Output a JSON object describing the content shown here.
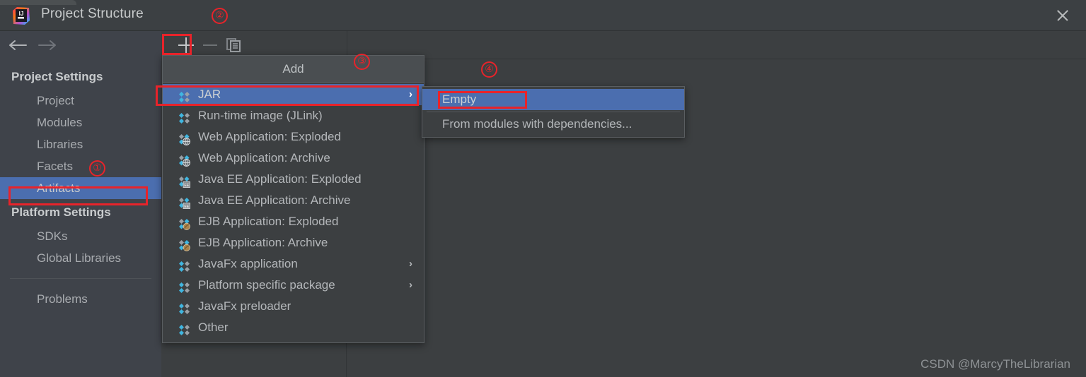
{
  "window": {
    "title": "Project Structure",
    "logo_icon": "intellij-idea-logo",
    "close_icon": "close-icon"
  },
  "nav": {
    "back_icon": "arrow-left-icon",
    "forward_icon": "arrow-right-icon"
  },
  "sidebar": {
    "groups": [
      {
        "label": "Project Settings",
        "items": [
          {
            "label": "Project",
            "selected": false
          },
          {
            "label": "Modules",
            "selected": false
          },
          {
            "label": "Libraries",
            "selected": false
          },
          {
            "label": "Facets",
            "selected": false
          },
          {
            "label": "Artifacts",
            "selected": true
          }
        ]
      },
      {
        "label": "Platform Settings",
        "items": [
          {
            "label": "SDKs",
            "selected": false
          },
          {
            "label": "Global Libraries",
            "selected": false
          }
        ]
      }
    ],
    "footer_items": [
      {
        "label": "Problems",
        "selected": false
      }
    ]
  },
  "toolbar": {
    "add_icon": "plus-icon",
    "remove_icon": "minus-icon",
    "copy_icon": "copy-icon"
  },
  "add_menu": {
    "header": "Add",
    "items": [
      {
        "label": "JAR",
        "icon": "artifact-jar-icon",
        "selected": true,
        "submenu": true
      },
      {
        "label": "Run-time image (JLink)",
        "icon": "artifact-jar-icon",
        "selected": false,
        "submenu": false
      },
      {
        "label": "Web Application: Exploded",
        "icon": "artifact-web-icon",
        "selected": false,
        "submenu": false
      },
      {
        "label": "Web Application: Archive",
        "icon": "artifact-web-icon",
        "selected": false,
        "submenu": false
      },
      {
        "label": "Java EE Application: Exploded",
        "icon": "artifact-javaee-icon",
        "selected": false,
        "submenu": false
      },
      {
        "label": "Java EE Application: Archive",
        "icon": "artifact-javaee-icon",
        "selected": false,
        "submenu": false
      },
      {
        "label": "EJB Application: Exploded",
        "icon": "artifact-ejb-icon",
        "selected": false,
        "submenu": false
      },
      {
        "label": "EJB Application: Archive",
        "icon": "artifact-ejb-icon",
        "selected": false,
        "submenu": false
      },
      {
        "label": "JavaFx application",
        "icon": "artifact-jar-icon",
        "selected": false,
        "submenu": true
      },
      {
        "label": "Platform specific package",
        "icon": "artifact-jar-icon",
        "selected": false,
        "submenu": true
      },
      {
        "label": "JavaFx preloader",
        "icon": "artifact-jar-icon",
        "selected": false,
        "submenu": false
      },
      {
        "label": "Other",
        "icon": "artifact-jar-icon",
        "selected": false,
        "submenu": false
      }
    ],
    "submenu_arrow": "›"
  },
  "jar_submenu": {
    "items": [
      {
        "label": "Empty",
        "selected": true
      },
      {
        "label": "From modules with dependencies...",
        "selected": false
      }
    ]
  },
  "annotations": [
    {
      "marker": "①"
    },
    {
      "marker": "②"
    },
    {
      "marker": "③"
    },
    {
      "marker": "④"
    }
  ],
  "watermark": "CSDN @MarcyTheLibrarian",
  "colors": {
    "selection_blue": "#4b6eaf",
    "annotation_red": "#e8232a",
    "window_bg": "#3c3f41",
    "sidebar_bg": "#3f434a",
    "menu_header_bg": "#4a4e51",
    "icon_cyan": "#40b6e0",
    "icon_gray": "#9aa0a6"
  }
}
